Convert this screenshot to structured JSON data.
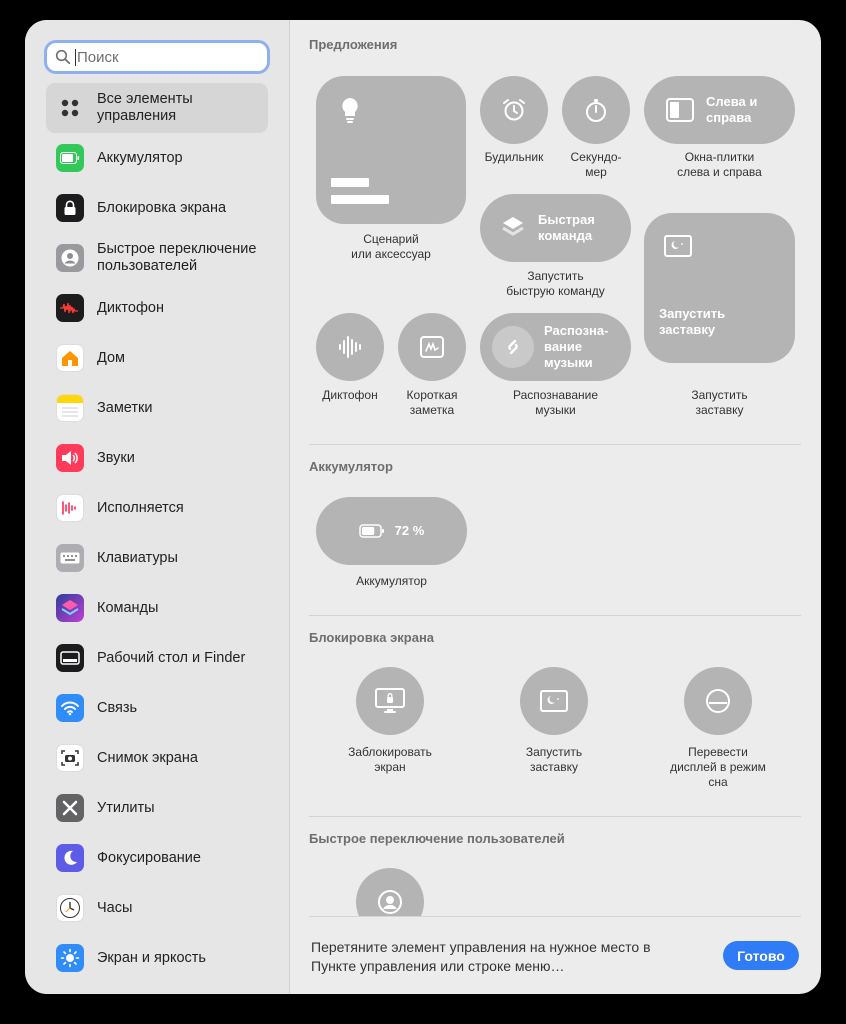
{
  "search": {
    "placeholder": "Поиск"
  },
  "sidebar": {
    "items": [
      {
        "label": "Все элементы управления",
        "icon": "grid-icon",
        "color": "#e6e6e6"
      },
      {
        "label": "Аккумулятор",
        "icon": "battery-icon",
        "color": "#34c759"
      },
      {
        "label": "Блокировка экрана",
        "icon": "lock-icon",
        "color": "#1c1c1e"
      },
      {
        "label": "Быстрое переключение пользователей",
        "icon": "user-switch-icon",
        "color": "#8e8e93"
      },
      {
        "label": "Диктофон",
        "icon": "voice-memo-icon",
        "color": "#1c1c1e"
      },
      {
        "label": "Дом",
        "icon": "home-icon",
        "color": "#ffffff"
      },
      {
        "label": "Заметки",
        "icon": "notes-icon",
        "color": "#ffffff"
      },
      {
        "label": "Звуки",
        "icon": "speaker-icon",
        "color": "#ff3b5c"
      },
      {
        "label": "Исполняется",
        "icon": "now-playing-icon",
        "color": "#ffffff"
      },
      {
        "label": "Клавиатуры",
        "icon": "keyboard-icon",
        "color": "#9a9a9e"
      },
      {
        "label": "Команды",
        "icon": "shortcuts-icon",
        "color": "#5b3cc4"
      },
      {
        "label": "Рабочий стол и Finder",
        "icon": "desktop-icon",
        "color": "#1c1c1e"
      },
      {
        "label": "Связь",
        "icon": "wifi-icon",
        "color": "#2f8cf8"
      },
      {
        "label": "Снимок экрана",
        "icon": "screenshot-icon",
        "color": "#ffffff"
      },
      {
        "label": "Утилиты",
        "icon": "utilities-icon",
        "color": "#636366"
      },
      {
        "label": "Фокусирование",
        "icon": "moon-icon",
        "color": "#5e5ce6"
      },
      {
        "label": "Часы",
        "icon": "clock-icon",
        "color": "#ffffff"
      },
      {
        "label": "Экран и яркость",
        "icon": "sun-icon",
        "color": "#2f8cf8"
      }
    ]
  },
  "suggestions": {
    "title": "Предложения",
    "scene": "Сценарий\nили аксессуар",
    "alarm": "Будильник",
    "stopwatch": "Секундо-\nмер",
    "tiles_pill": "Слева и\nсправа",
    "tiles_caption": "Окна-плитки\nслева и справа",
    "shortcut_pill": "Быстрая\nкоманда",
    "shortcut_caption": "Запустить\nбыструю команду",
    "screensaver_tile": "Запустить\nзаставку",
    "screensaver_caption": "Запустить\nзаставку",
    "voice_memo": "Диктофон",
    "quick_note": "Короткая\nзаметка",
    "music_pill": "Распозна-\nвание\nмузыки",
    "music_caption": "Распознавание\nмузыки"
  },
  "battery": {
    "title": "Аккумулятор",
    "percent": "72 %",
    "level": 0.72,
    "caption": "Аккумулятор"
  },
  "lock": {
    "title": "Блокировка экрана",
    "lock_caption": "Заблокировать\nэкран",
    "screensaver_caption": "Запустить\nзаставку",
    "sleep_caption": "Перевести\nдисплей в режим\nсна"
  },
  "fast_user": {
    "title": "Быстрое переключение пользователей"
  },
  "footer": {
    "hint": "Перетяните элемент управления на нужное место в Пункте управления или строке меню…",
    "done": "Готово"
  }
}
